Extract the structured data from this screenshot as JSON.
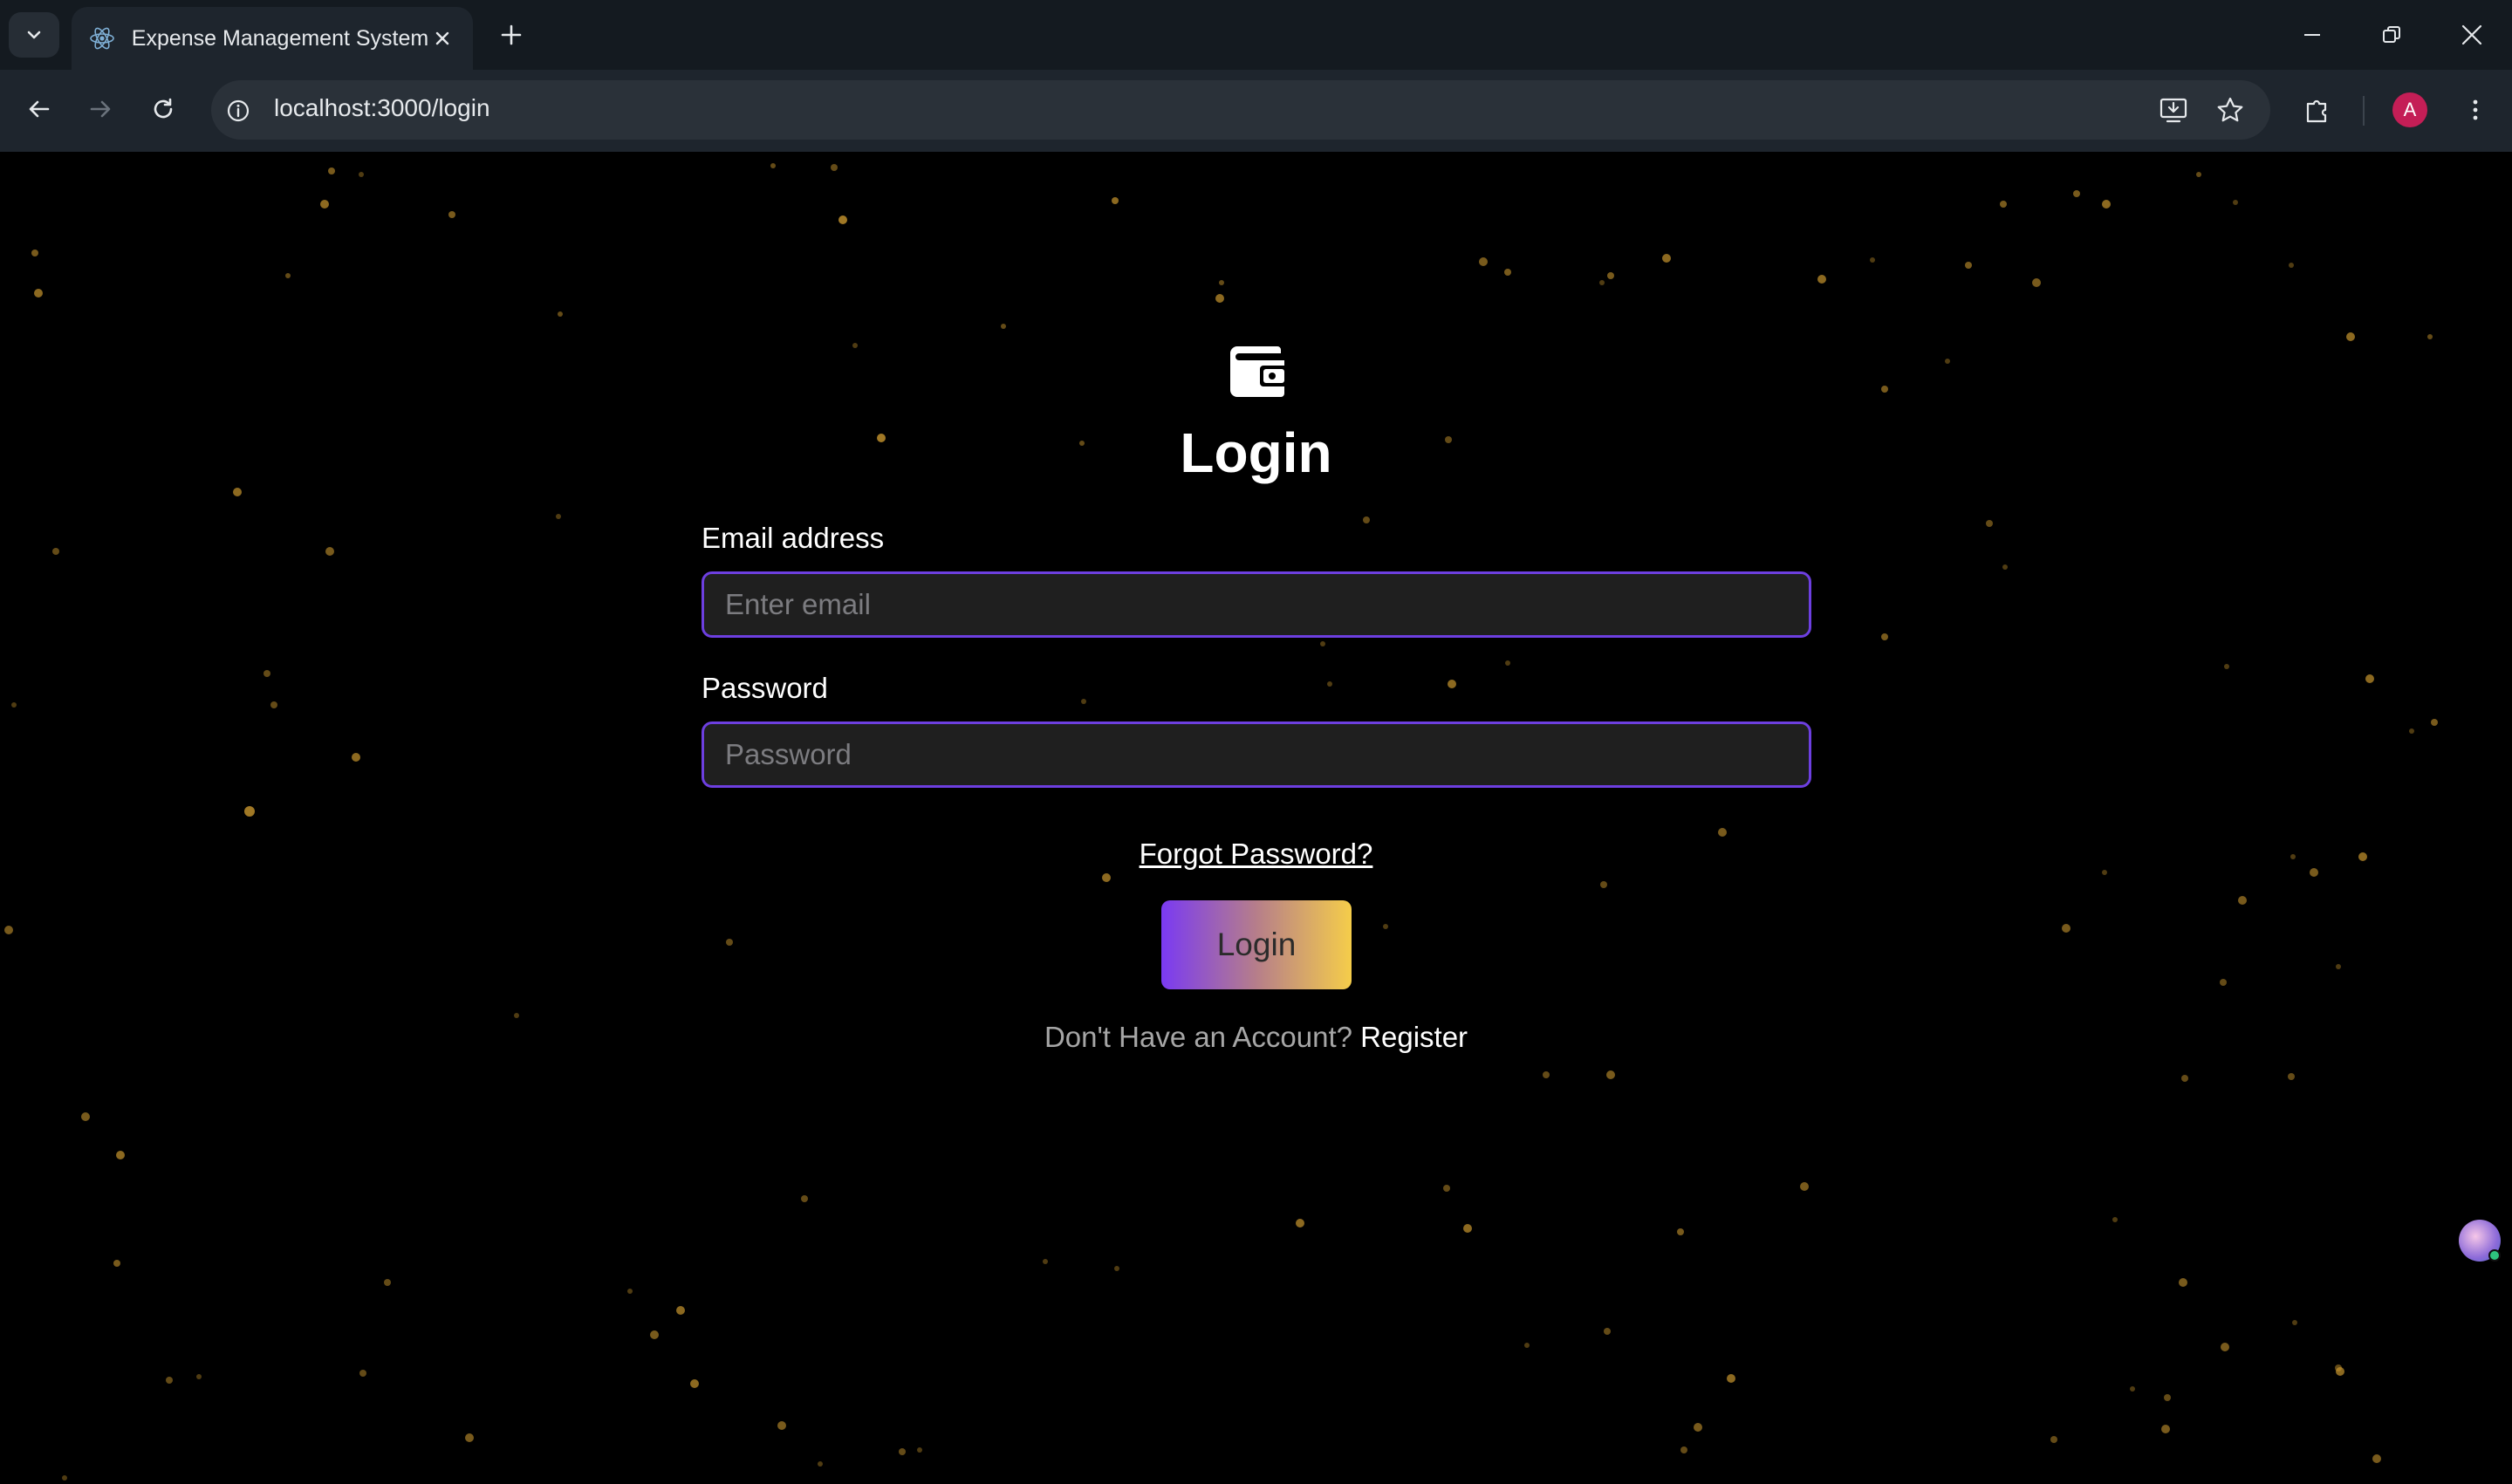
{
  "browser": {
    "tab_title": "Expense Management System",
    "url": "localhost:3000/login",
    "profile_initial": "A",
    "icons": {
      "tab_menu": "chevron-down-icon",
      "favicon": "react-icon",
      "tab_close": "close-icon",
      "new_tab": "plus-icon",
      "minimize": "minimize-icon",
      "restore": "restore-icon",
      "close_window": "close-icon",
      "back": "arrow-left-icon",
      "forward": "arrow-right-icon",
      "reload": "reload-icon",
      "site_info": "info-icon",
      "install": "install-app-icon",
      "bookmark": "star-icon",
      "extensions": "puzzle-icon",
      "menu": "kebab-menu-icon"
    }
  },
  "login": {
    "logo_icon": "wallet-icon",
    "title": "Login",
    "email_label": "Email address",
    "email_placeholder": "Enter email",
    "email_value": "",
    "password_label": "Password",
    "password_placeholder": "Password",
    "password_value": "",
    "forgot_link": "Forgot Password?",
    "submit_label": "Login",
    "register_prompt": "Don't Have an Account?",
    "register_link": "Register"
  },
  "colors": {
    "background": "#000000",
    "input_border": "#6d3fe0",
    "input_bg": "#1f1f1f",
    "button_gradient_start": "#7a3af2",
    "button_gradient_end": "#f5cd4a",
    "star": "#c8962e"
  }
}
